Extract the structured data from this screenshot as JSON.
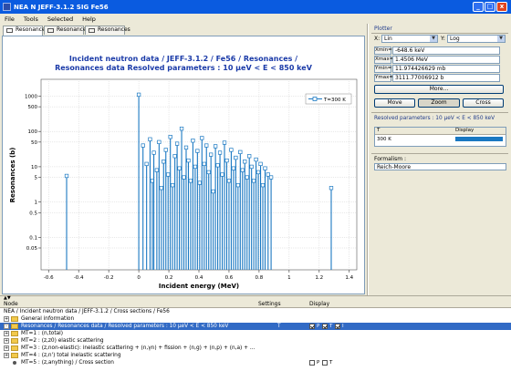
{
  "window": {
    "title": "NEA N JEFF-3.1.2 SIG Fe56",
    "minimize": "_",
    "maximize": "□",
    "close": "x"
  },
  "menu": [
    "File",
    "Tools",
    "Selected",
    "Help"
  ],
  "tabs": [
    "Resonances",
    "Resonances",
    "Resonances"
  ],
  "plotter": {
    "title": "Plotter",
    "x_label": "X:",
    "x_scale": "Lin",
    "y_label": "Y:",
    "y_scale": "Log",
    "ranges": [
      {
        "key": "Xmin=",
        "value": "-648.6 keV"
      },
      {
        "key": "Xmax=",
        "value": "1.4506 MeV"
      },
      {
        "key": "Ymin=",
        "value": "11.974426629 mb"
      },
      {
        "key": "Ymax=",
        "value": "3111.77006912 b"
      }
    ],
    "more": "More...",
    "move": "Move",
    "zoom": "Zoom",
    "cross": "Cross"
  },
  "resolved": {
    "title": "Resolved parameters : 10 µeV < E < 850 keV",
    "col_t": "T",
    "col_display": "Display",
    "row_t": "300 K",
    "color": "#1a78c2"
  },
  "formalism": {
    "label": "Formalism :",
    "value": "Reich-Moore"
  },
  "tree": {
    "col_node": "Node",
    "col_settings": "Settings",
    "col_display": "Display",
    "rows": [
      {
        "text": "NEA / Incident neutron data / JEFF-3.1.2 / Cross sections / Fe56",
        "indent": 0,
        "kind": "none"
      },
      {
        "text": "General information",
        "indent": 1,
        "kind": "folder",
        "exp": "+"
      },
      {
        "text": "Resonances / Resonances data / Resolved parameters : 10 µeV < E < 850 keV",
        "indent": 1,
        "kind": "folder",
        "exp": "-",
        "selected": true,
        "settings": "T",
        "display": [
          "P",
          "T",
          "I"
        ]
      },
      {
        "text": "MT=1 : (n,total)",
        "indent": 1,
        "kind": "folder",
        "exp": "+"
      },
      {
        "text": "MT=2 : (z,z0) elastic scattering",
        "indent": 1,
        "kind": "folder",
        "exp": "+"
      },
      {
        "text": "MT=3 : (z,non-elastic): inelastic scattering + (n,γn) + fission + (n,g) + (n,p) + (n,a) + ...",
        "indent": 1,
        "kind": "folder",
        "exp": "+"
      },
      {
        "text": "MT=4 : (z,n') total inelastic scattering",
        "indent": 1,
        "kind": "folder",
        "exp": "+"
      },
      {
        "text": "MT=5 : (z,anything) / Cross section",
        "indent": 1,
        "kind": "bullet",
        "display": [
          "P",
          "T"
        ]
      }
    ]
  },
  "chart_data": {
    "type": "scatter",
    "title": "Incident neutron data / JEFF-3.1.2 / Fe56 / Resonances /",
    "subtitle": "Resonances data Resolved parameters : 10 µeV < E < 850 keV",
    "xlabel": "Incident energy (MeV)",
    "ylabel": "Resonances (b)",
    "xlim": [
      -0.65,
      1.45
    ],
    "ylim": [
      0.012,
      3000
    ],
    "yscale": "log",
    "xticks": [
      -0.6,
      -0.4,
      -0.2,
      0,
      0.2,
      0.4,
      0.6,
      0.8,
      1,
      1.2,
      1.4
    ],
    "xticklabels": [
      "-0.6",
      "-0.4",
      "-0.2",
      "0",
      "0.2",
      "0.4",
      "0.6",
      "0.8",
      "1",
      "1.2",
      "1.4"
    ],
    "yticks": [
      1000,
      500,
      100,
      50,
      10,
      5,
      1,
      0.5,
      0.1,
      0.05
    ],
    "yticklabels": [
      "1000",
      "500",
      "100",
      "50",
      "10",
      "5",
      "1",
      "0.5",
      "0.1",
      "0.05"
    ],
    "grid": true,
    "legend": {
      "position": "top-right"
    },
    "series": [
      {
        "name": "T=300 K",
        "color": "#1a78c2",
        "style": "stem",
        "points": [
          [
            -0.48,
            5.5
          ],
          [
            0.0,
            1100
          ],
          [
            0.028,
            40
          ],
          [
            0.052,
            12
          ],
          [
            0.075,
            60
          ],
          [
            0.09,
            4
          ],
          [
            0.1,
            25
          ],
          [
            0.12,
            8
          ],
          [
            0.135,
            50
          ],
          [
            0.15,
            2.5
          ],
          [
            0.165,
            14
          ],
          [
            0.18,
            30
          ],
          [
            0.195,
            6
          ],
          [
            0.21,
            70
          ],
          [
            0.225,
            3
          ],
          [
            0.24,
            20
          ],
          [
            0.255,
            45
          ],
          [
            0.27,
            9
          ],
          [
            0.285,
            120
          ],
          [
            0.3,
            5
          ],
          [
            0.315,
            35
          ],
          [
            0.33,
            15
          ],
          [
            0.345,
            4
          ],
          [
            0.36,
            55
          ],
          [
            0.375,
            10
          ],
          [
            0.39,
            28
          ],
          [
            0.405,
            3.5
          ],
          [
            0.42,
            65
          ],
          [
            0.435,
            12
          ],
          [
            0.45,
            40
          ],
          [
            0.465,
            7
          ],
          [
            0.48,
            22
          ],
          [
            0.495,
            2
          ],
          [
            0.51,
            38
          ],
          [
            0.525,
            11
          ],
          [
            0.54,
            25
          ],
          [
            0.555,
            6
          ],
          [
            0.57,
            48
          ],
          [
            0.585,
            15
          ],
          [
            0.6,
            4
          ],
          [
            0.615,
            30
          ],
          [
            0.63,
            9
          ],
          [
            0.645,
            18
          ],
          [
            0.66,
            3
          ],
          [
            0.675,
            26
          ],
          [
            0.69,
            8
          ],
          [
            0.705,
            14
          ],
          [
            0.72,
            5
          ],
          [
            0.735,
            20
          ],
          [
            0.75,
            10
          ],
          [
            0.765,
            4
          ],
          [
            0.78,
            16
          ],
          [
            0.795,
            7
          ],
          [
            0.81,
            12
          ],
          [
            0.825,
            3
          ],
          [
            0.84,
            9
          ],
          [
            0.86,
            6
          ],
          [
            0.88,
            5
          ],
          [
            1.28,
            2.5
          ]
        ]
      }
    ]
  }
}
